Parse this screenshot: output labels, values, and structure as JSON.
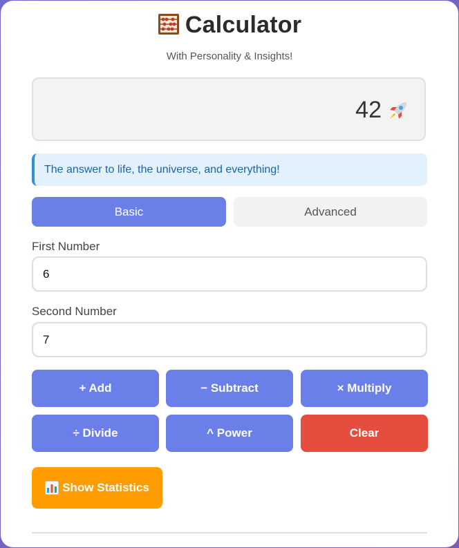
{
  "header": {
    "title": "Calculator",
    "subtitle": "With Personality & Insights!",
    "title_icon": "abacus-icon"
  },
  "display": {
    "value": "42",
    "emoji_icon": "rocket-icon"
  },
  "message": "The answer to life, the universe, and everything!",
  "tabs": [
    {
      "label": "Basic",
      "active": true
    },
    {
      "label": "Advanced",
      "active": false
    }
  ],
  "inputs": {
    "first_label": "First Number",
    "first_value": "6",
    "second_label": "Second Number",
    "second_value": "7"
  },
  "buttons": {
    "add": "+ Add",
    "subtract": "− Subtract",
    "multiply": "× Multiply",
    "divide": "÷ Divide",
    "power": "^ Power",
    "clear": "Clear",
    "stats": "Show Statistics",
    "stats_icon": "bar-chart-icon"
  },
  "colors": {
    "primary": "#6b7fe9",
    "danger": "#e54e3f",
    "warning": "#ff9d00",
    "info_bg": "#e3f1fc",
    "info_accent": "#2d8fe6"
  }
}
